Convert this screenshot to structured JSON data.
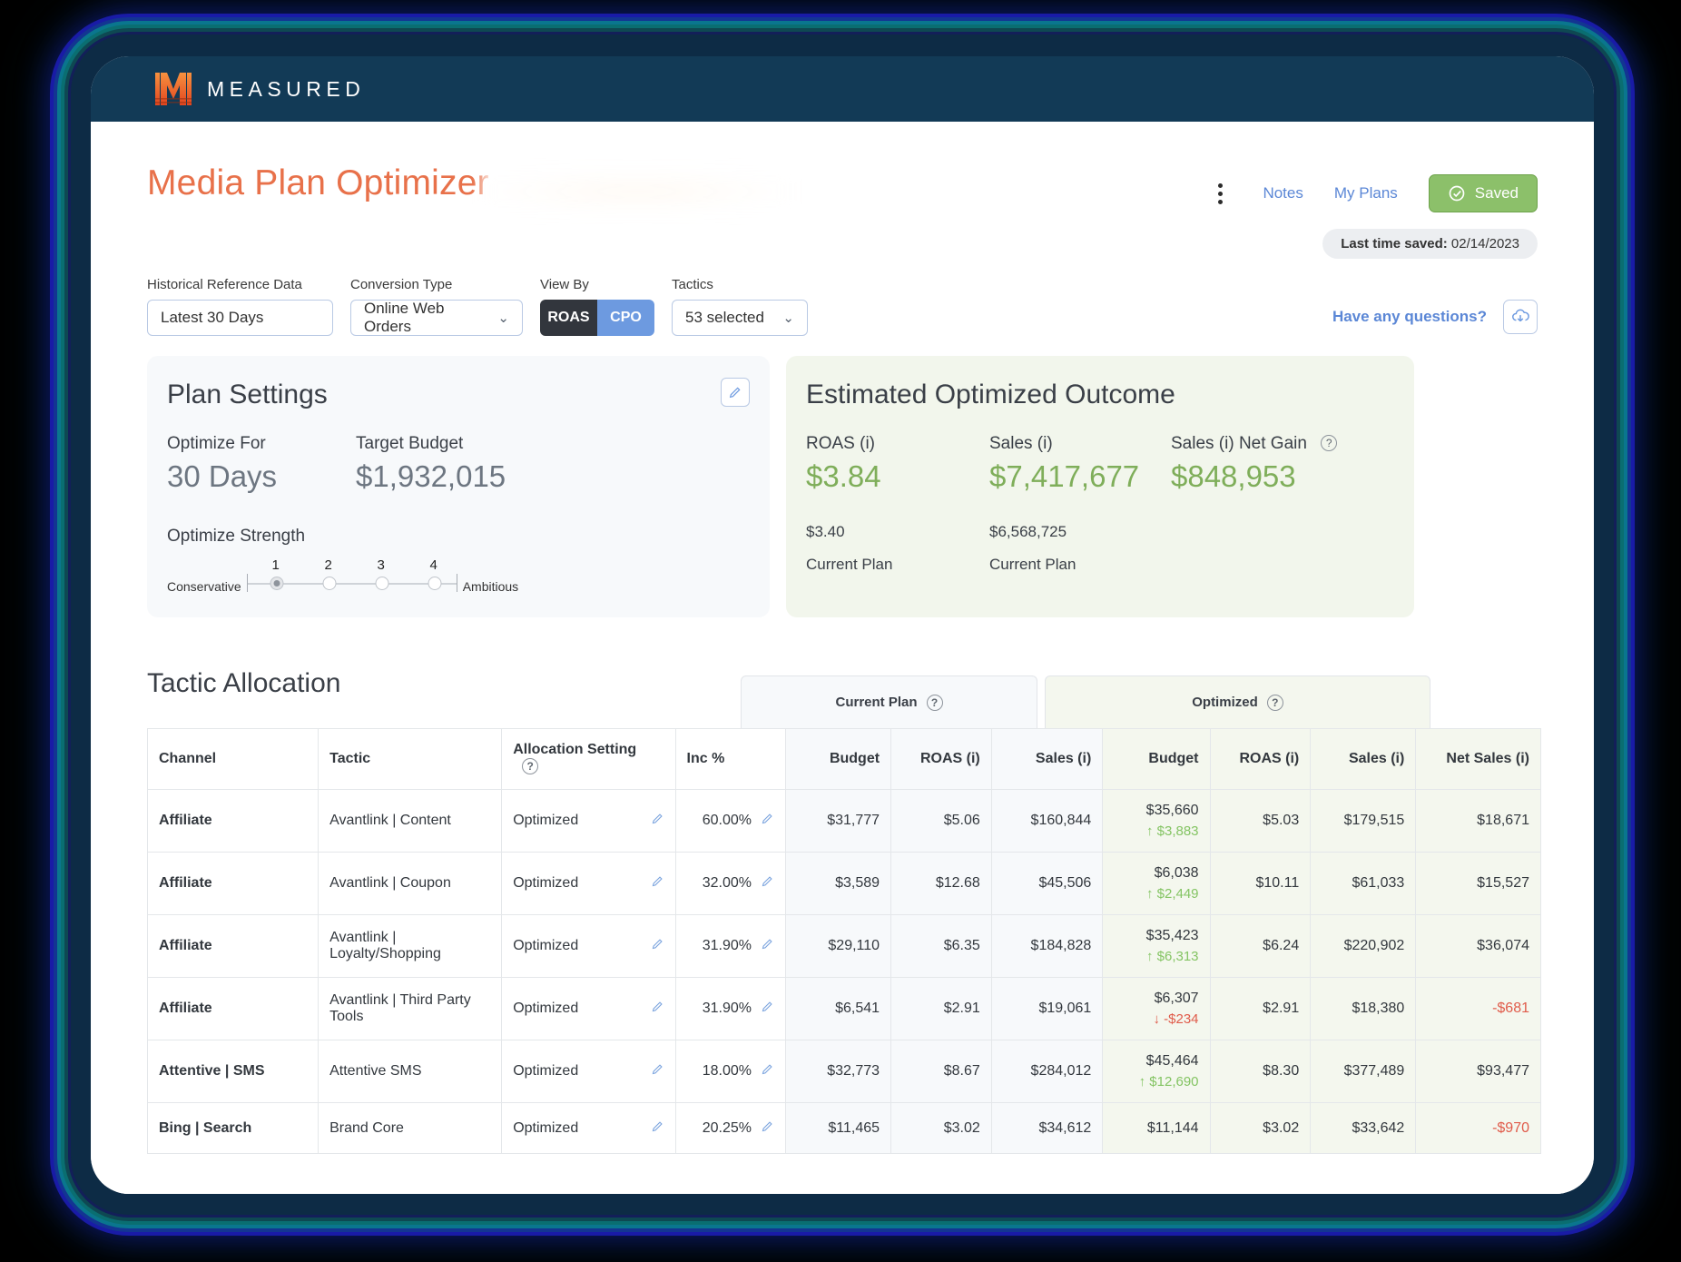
{
  "brand": {
    "name": "MEASURED"
  },
  "header": {
    "page_title": "Media Plan Optimizer",
    "notes_label": "Notes",
    "my_plans_label": "My Plans",
    "saved_label": "Saved",
    "last_saved_prefix": "Last time saved:",
    "last_saved_date": "02/14/2023"
  },
  "filters": {
    "historical_label": "Historical Reference Data",
    "historical_value": "Latest 30 Days",
    "conversion_label": "Conversion Type",
    "conversion_value": "Online Web Orders",
    "viewby_label": "View By",
    "viewby_roas": "ROAS",
    "viewby_cpo": "CPO",
    "tactics_label": "Tactics",
    "tactics_value": "53 selected",
    "questions_link": "Have any questions?"
  },
  "plan_settings": {
    "title": "Plan Settings",
    "optimize_for_label": "Optimize For",
    "optimize_for_value": "30 Days",
    "target_budget_label": "Target Budget",
    "target_budget_value": "$1,932,015",
    "strength_label": "Optimize Strength",
    "strength_min_label": "Conservative",
    "strength_max_label": "Ambitious",
    "strength_ticks": [
      "1",
      "2",
      "3",
      "4"
    ],
    "strength_selected": 1
  },
  "outcome": {
    "title": "Estimated Optimized Outcome",
    "metrics": [
      {
        "label": "ROAS (i)",
        "value": "$3.84",
        "sub_value": "$3.40",
        "sub_label": "Current Plan"
      },
      {
        "label": "Sales (i)",
        "value": "$7,417,677",
        "sub_value": "$6,568,725",
        "sub_label": "Current Plan"
      },
      {
        "label": "Sales (i) Net Gain",
        "value": "$848,953",
        "sub_value": "",
        "sub_label": ""
      }
    ]
  },
  "table": {
    "title": "Tactic Allocation",
    "group_current": "Current Plan",
    "group_optimized": "Optimized",
    "columns": {
      "channel": "Channel",
      "tactic": "Tactic",
      "allocation": "Allocation Setting",
      "inc": "Inc %",
      "cur_budget": "Budget",
      "cur_roas": "ROAS (i)",
      "cur_sales": "Sales (i)",
      "opt_budget": "Budget",
      "opt_roas": "ROAS (i)",
      "opt_sales": "Sales (i)",
      "opt_net": "Net Sales (i)"
    },
    "rows": [
      {
        "channel": "Affiliate",
        "tactic": "Avantlink | Content",
        "allocation": "Optimized",
        "inc": "60.00%",
        "cur_budget": "$31,777",
        "cur_roas": "$5.06",
        "cur_sales": "$160,844",
        "opt_budget": "$35,660",
        "opt_delta": "↑ $3,883",
        "opt_delta_dir": "up",
        "opt_roas": "$5.03",
        "opt_sales": "$179,515",
        "opt_net": "$18,671",
        "opt_net_neg": false
      },
      {
        "channel": "Affiliate",
        "tactic": "Avantlink | Coupon",
        "allocation": "Optimized",
        "inc": "32.00%",
        "cur_budget": "$3,589",
        "cur_roas": "$12.68",
        "cur_sales": "$45,506",
        "opt_budget": "$6,038",
        "opt_delta": "↑ $2,449",
        "opt_delta_dir": "up",
        "opt_roas": "$10.11",
        "opt_sales": "$61,033",
        "opt_net": "$15,527",
        "opt_net_neg": false
      },
      {
        "channel": "Affiliate",
        "tactic": "Avantlink | Loyalty/Shopping",
        "allocation": "Optimized",
        "inc": "31.90%",
        "cur_budget": "$29,110",
        "cur_roas": "$6.35",
        "cur_sales": "$184,828",
        "opt_budget": "$35,423",
        "opt_delta": "↑ $6,313",
        "opt_delta_dir": "up",
        "opt_roas": "$6.24",
        "opt_sales": "$220,902",
        "opt_net": "$36,074",
        "opt_net_neg": false
      },
      {
        "channel": "Affiliate",
        "tactic": "Avantlink | Third Party Tools",
        "allocation": "Optimized",
        "inc": "31.90%",
        "cur_budget": "$6,541",
        "cur_roas": "$2.91",
        "cur_sales": "$19,061",
        "opt_budget": "$6,307",
        "opt_delta": "↓ -$234",
        "opt_delta_dir": "down",
        "opt_roas": "$2.91",
        "opt_sales": "$18,380",
        "opt_net": "-$681",
        "opt_net_neg": true
      },
      {
        "channel": "Attentive | SMS",
        "tactic": "Attentive SMS",
        "allocation": "Optimized",
        "inc": "18.00%",
        "cur_budget": "$32,773",
        "cur_roas": "$8.67",
        "cur_sales": "$284,012",
        "opt_budget": "$45,464",
        "opt_delta": "↑ $12,690",
        "opt_delta_dir": "up",
        "opt_roas": "$8.30",
        "opt_sales": "$377,489",
        "opt_net": "$93,477",
        "opt_net_neg": false
      },
      {
        "channel": "Bing | Search",
        "tactic": "Brand Core",
        "allocation": "Optimized",
        "inc": "20.25%",
        "cur_budget": "$11,465",
        "cur_roas": "$3.02",
        "cur_sales": "$34,612",
        "opt_budget": "$11,144",
        "opt_delta": "",
        "opt_delta_dir": "",
        "opt_roas": "$3.02",
        "opt_sales": "$33,642",
        "opt_net": "-$970",
        "opt_net_neg": true
      }
    ]
  },
  "icons": {
    "kebab": "more-vertical-icon",
    "check": "check-circle-icon",
    "pencil": "pencil-icon",
    "download": "cloud-download-icon",
    "help": "?"
  }
}
